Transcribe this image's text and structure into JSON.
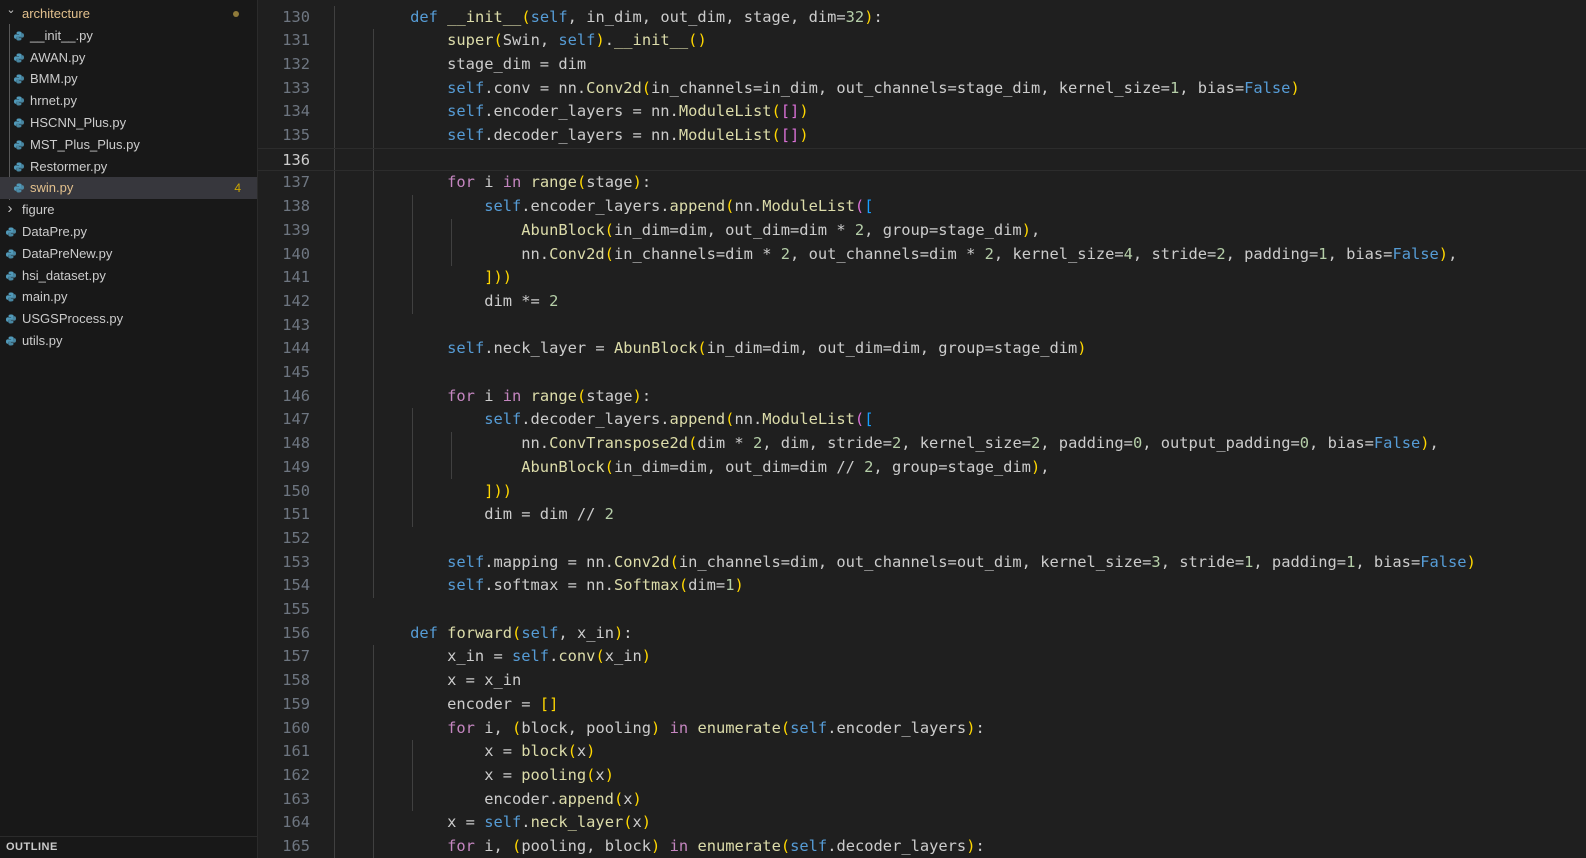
{
  "explorer": {
    "folder": "architecture",
    "folder_files": [
      "__init__.py",
      "AWAN.py",
      "BMM.py",
      "hrnet.py",
      "HSCNN_Plus.py",
      "MST_Plus_Plus.py",
      "Restormer.py",
      "swin.py"
    ],
    "active_file": "swin.py",
    "active_badge": "4",
    "subfolder": "figure",
    "root_files": [
      "DataPre.py",
      "DataPreNew.py",
      "hsi_dataset.py",
      "main.py",
      "USGSProcess.py",
      "utils.py"
    ],
    "outline_label": "OUTLINE"
  },
  "editor": {
    "first_line_number": 130,
    "current_line": 136,
    "lines": [
      "    def __init__(self, in_dim, out_dim, stage, dim=32):",
      "        super(Swin, self).__init__()",
      "        stage_dim = dim",
      "        self.conv = nn.Conv2d(in_channels=in_dim, out_channels=stage_dim, kernel_size=1, bias=False)",
      "        self.encoder_layers = nn.ModuleList([])",
      "        self.decoder_layers = nn.ModuleList([])",
      "",
      "        for i in range(stage):",
      "            self.encoder_layers.append(nn.ModuleList([",
      "                AbunBlock(in_dim=dim, out_dim=dim * 2, group=stage_dim),",
      "                nn.Conv2d(in_channels=dim * 2, out_channels=dim * 2, kernel_size=4, stride=2, padding=1, bias=False),",
      "            ]))",
      "            dim *= 2",
      "",
      "        self.neck_layer = AbunBlock(in_dim=dim, out_dim=dim, group=stage_dim)",
      "",
      "        for i in range(stage):",
      "            self.decoder_layers.append(nn.ModuleList([",
      "                nn.ConvTranspose2d(dim * 2, dim, stride=2, kernel_size=2, padding=0, output_padding=0, bias=False),",
      "                AbunBlock(in_dim=dim, out_dim=dim // 2, group=stage_dim),",
      "            ]))",
      "            dim = dim // 2",
      "",
      "        self.mapping = nn.Conv2d(in_channels=dim, out_channels=out_dim, kernel_size=3, stride=1, padding=1, bias=False)",
      "        self.softmax = nn.Softmax(dim=1)",
      "",
      "    def forward(self, x_in):",
      "        x_in = self.conv(x_in)",
      "        x = x_in",
      "        encoder = []",
      "        for i, (block, pooling) in enumerate(self.encoder_layers):",
      "            x = block(x)",
      "            x = pooling(x)",
      "            encoder.append(x)",
      "        x = self.neck_layer(x)",
      "        for i, (pooling, block) in enumerate(self.decoder_layers):"
    ]
  },
  "colors": {
    "keyword": "#569cd6",
    "control": "#c586c0",
    "function": "#dcdcaa",
    "number": "#b5cea8",
    "bracket1": "#ffd700",
    "bracket2": "#da70d6",
    "bracket3": "#179fff",
    "modified": "#e2c08d"
  }
}
